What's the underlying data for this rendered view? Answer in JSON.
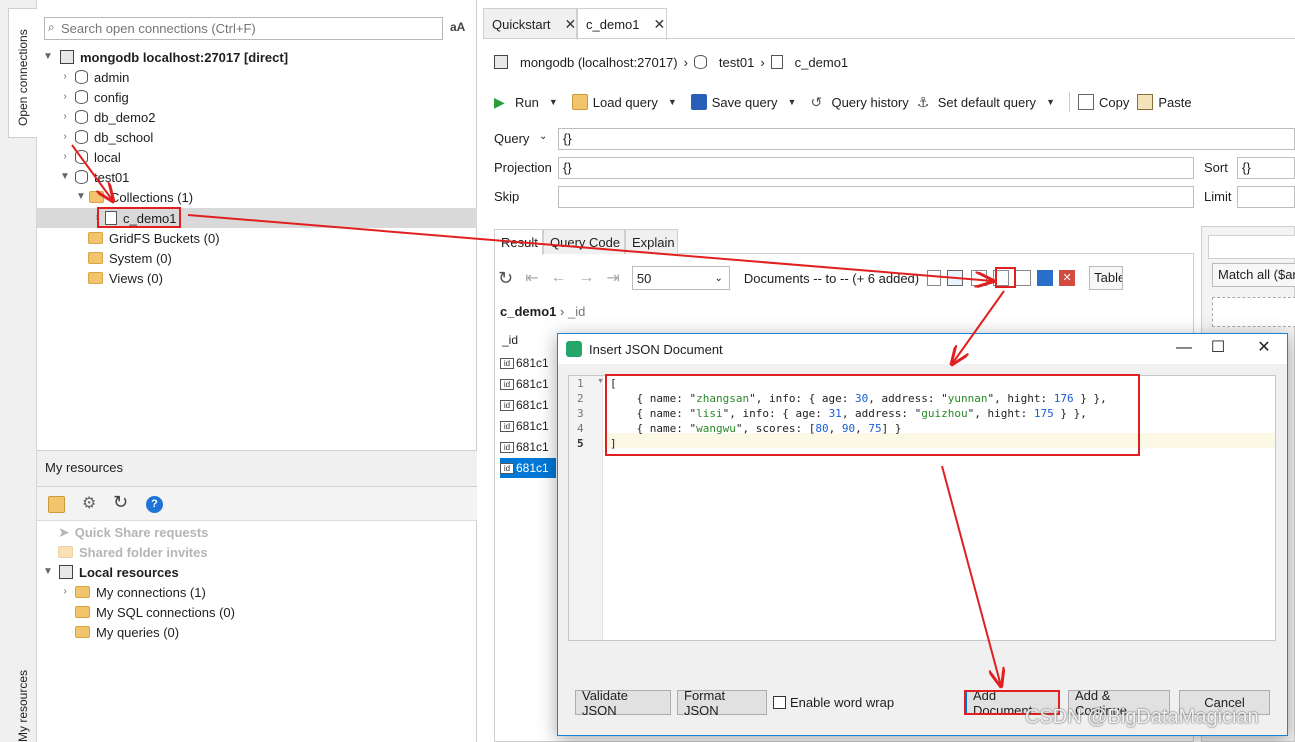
{
  "left_strip": {
    "open_connections_label": "Open connections",
    "my_resources_label": "My resources"
  },
  "search": {
    "placeholder": "Search open connections (Ctrl+F)",
    "case_toggle": "aA"
  },
  "tree": {
    "connection": "mongodb localhost:27017 [direct]",
    "databases": [
      "admin",
      "config",
      "db_demo2",
      "db_school",
      "local",
      "test01"
    ],
    "collections_folder": "Collections (1)",
    "collection": "c_demo1",
    "gridfs": "GridFS Buckets (0)",
    "system": "System (0)",
    "views": "Views (0)"
  },
  "my_resources": {
    "header": "My resources",
    "quick_share": "Quick Share requests",
    "shared_folder": "Shared folder invites",
    "local_resources": "Local resources",
    "my_connections": "My connections (1)",
    "my_sql_connections": "My SQL connections (0)",
    "my_queries": "My queries (0)"
  },
  "tabs": [
    "Quickstart",
    "c_demo1"
  ],
  "breadcrumb": {
    "conn": "mongodb (localhost:27017)",
    "db": "test01",
    "coll": "c_demo1"
  },
  "toolbar": {
    "run": "Run",
    "load_query": "Load query",
    "save_query": "Save query",
    "query_history": "Query history",
    "set_default_query": "Set default query",
    "copy": "Copy",
    "paste": "Paste"
  },
  "query": {
    "query_label": "Query",
    "query_value": "{}",
    "projection_label": "Projection",
    "projection_value": "{}",
    "skip_label": "Skip",
    "skip_value": "",
    "sort_label": "Sort",
    "sort_value": "{}",
    "limit_label": "Limit",
    "limit_value": ""
  },
  "result_tabs": [
    "Result",
    "Query Code",
    "Explain"
  ],
  "result": {
    "page_size": "50",
    "documents_text": "Documents -- to -- (+ 6 added)",
    "view_button": "Table",
    "path_root": "c_demo1",
    "path_field": "_id",
    "column_header": "_id",
    "id_cells": [
      "681c1",
      "681c1",
      "681c1",
      "681c1",
      "681c1",
      "681c1"
    ],
    "filter_match": "Match all ($ar"
  },
  "dialog": {
    "title": "Insert JSON Document",
    "line_numbers": [
      "1",
      "2",
      "3",
      "4",
      "5"
    ],
    "validate": "Validate JSON",
    "format": "Format JSON",
    "word_wrap": "Enable word wrap",
    "add": "Add Document",
    "add_continue": "Add & Continue",
    "cancel": "Cancel"
  },
  "json_docs": [
    {
      "name": "zhangsan",
      "age": 30,
      "address": "yunnan",
      "hight": 176
    },
    {
      "name": "lisi",
      "age": 31,
      "address": "guizhou",
      "hight": 175
    },
    {
      "name": "wangwu",
      "scores": [
        80,
        90,
        75
      ]
    }
  ],
  "watermark": "CSDN @BigDataMagician"
}
